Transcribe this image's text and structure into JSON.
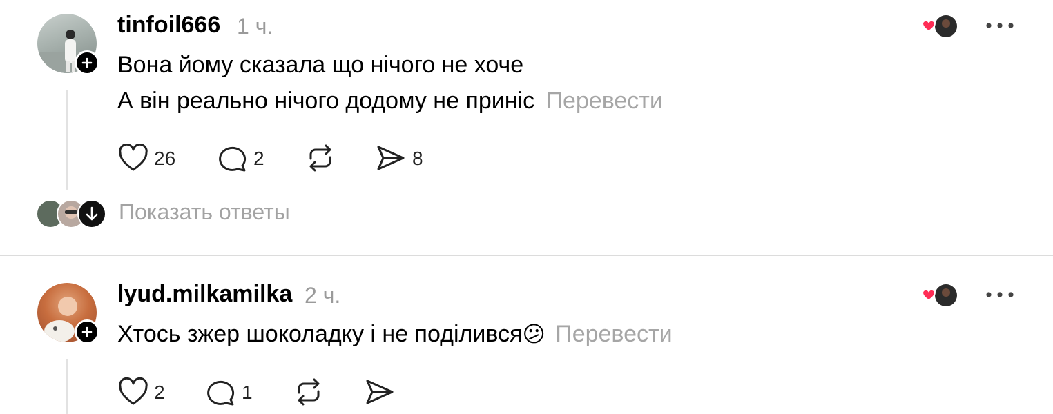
{
  "comments": [
    {
      "username": "tinfoil666",
      "time": "1 ч.",
      "lines": [
        "Вона йому сказала що нічого не хоче",
        "А він реально нічого додому не приніс"
      ],
      "translate_label": "Перевести",
      "likes": "26",
      "replies": "2",
      "shares": "8",
      "show_replies_label": "Показать ответы"
    },
    {
      "username": "lyud.milkamilka",
      "time": "2 ч.",
      "lines": [
        "Хтось зжер шоколадку і не поділився"
      ],
      "emoji": "😕",
      "translate_label": "Перевести",
      "likes": "2",
      "replies": "1"
    }
  ],
  "icons": {
    "like": "heart-outline-icon",
    "reply": "comment-bubble-icon",
    "repost": "repost-icon",
    "share": "send-icon",
    "more": "more-horizontal-icon",
    "follow": "plus-icon",
    "creator_liked": "red-heart-icon"
  },
  "colors": {
    "accent_heart": "#ff2d55",
    "muted_text": "#a6a6a6",
    "badge": "#000000"
  }
}
